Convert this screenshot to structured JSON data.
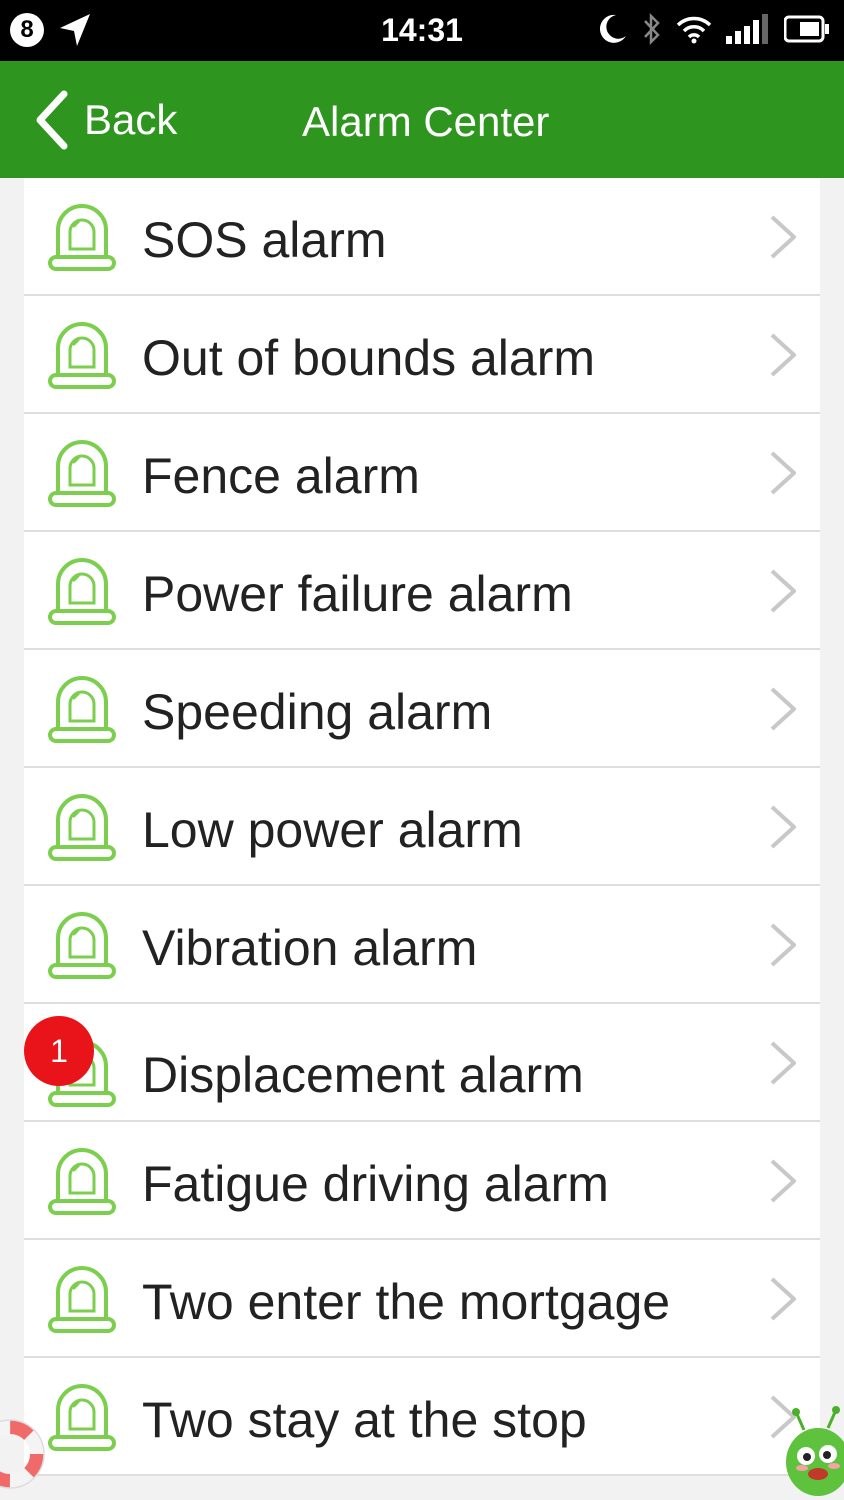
{
  "status_bar": {
    "notification_count": "8",
    "time": "14:31",
    "icons": [
      "location-arrow-icon",
      "moon-icon",
      "bluetooth-icon",
      "wifi-icon",
      "signal-icon",
      "battery-icon"
    ]
  },
  "header": {
    "back_label": "Back",
    "title": "Alarm Center"
  },
  "colors": {
    "header_bg": "#2e961f",
    "icon_green": "#7ccf4e",
    "badge_red": "#e8141a"
  },
  "alarms": [
    {
      "label": "SOS alarm"
    },
    {
      "label": "Out of bounds alarm"
    },
    {
      "label": "Fence alarm"
    },
    {
      "label": "Power failure alarm"
    },
    {
      "label": "Speeding alarm"
    },
    {
      "label": "Low power alarm"
    },
    {
      "label": "Vibration alarm"
    },
    {
      "label": "Displacement alarm",
      "badge": "1"
    },
    {
      "label": "Fatigue driving alarm"
    },
    {
      "label": "Two enter the mortgage"
    },
    {
      "label": "Two stay at the stop"
    }
  ]
}
